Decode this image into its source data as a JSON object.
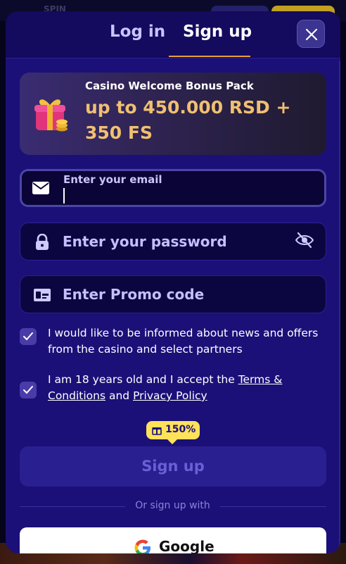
{
  "background": {
    "logo_text": "SPIN"
  },
  "header": {
    "tabs": [
      {
        "label": "Log in",
        "active": false
      },
      {
        "label": "Sign up",
        "active": true
      }
    ],
    "close_icon": "close-icon"
  },
  "bonus": {
    "title": "Casino Welcome Bonus Pack",
    "amount": "up to 450.000 RSD + 350 FS",
    "icon": "gift-icon"
  },
  "form": {
    "email": {
      "label": "Enter your email",
      "value": "",
      "icon": "envelope-icon"
    },
    "password": {
      "placeholder": "Enter your password",
      "icon": "lock-icon",
      "toggle_icon": "eye-off-icon"
    },
    "promo": {
      "placeholder": "Enter Promo code",
      "icon": "ticket-icon"
    }
  },
  "consents": {
    "news": {
      "checked": true,
      "text": "I would like to be informed about news and offers from the casino and select partners"
    },
    "age": {
      "checked": true,
      "prefix": "I am 18 years old and I accept the ",
      "terms_link": "Terms & Conditions",
      "and": " and ",
      "privacy_link": "Privacy Policy"
    }
  },
  "badge": {
    "value": "150%"
  },
  "submit": {
    "label": "Sign up"
  },
  "social": {
    "divider_text": "Or sign up with",
    "google_label": "Google"
  },
  "colors": {
    "modal_bg": "#1b1078",
    "accent_underline": "#e7a23a",
    "bonus_amount": "#f0c070",
    "badge": "#ffe25a"
  }
}
